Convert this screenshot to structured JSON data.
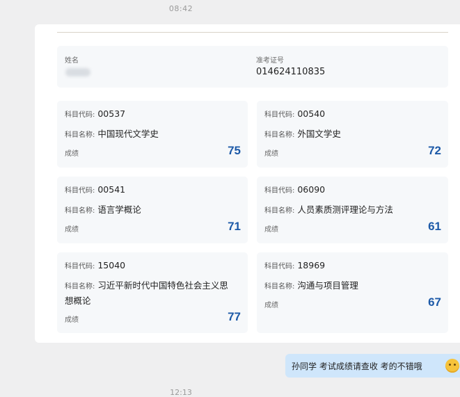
{
  "chat": {
    "time_top": "08:42",
    "time_bottom": "12:13",
    "message": "孙同学  考试成绩请查收   考的不错哦",
    "emoji_icon": "shy-smile-emoji"
  },
  "result": {
    "name_label": "姓名",
    "ticket_label": "准考证号",
    "ticket_value": "014624110835",
    "code_label": "科目代码:",
    "subject_label": "科目名称:",
    "score_label": "成绩",
    "subjects": [
      {
        "code": "00537",
        "name": "中国现代文学史",
        "score": "75"
      },
      {
        "code": "00540",
        "name": "外国文学史",
        "score": "72"
      },
      {
        "code": "00541",
        "name": "语言学概论",
        "score": "71"
      },
      {
        "code": "06090",
        "name": "人员素质测评理论与方法",
        "score": "61"
      },
      {
        "code": "15040",
        "name_line1": "习近平新时代中国特色社会主义思",
        "name_line2": "想概论",
        "score": "77"
      },
      {
        "code": "18969",
        "name": "沟通与项目管理",
        "score": "67"
      }
    ]
  },
  "colors": {
    "score": "#1d5aa8",
    "bubble": "#cfe6fb",
    "panel": "#f6f8fa"
  }
}
